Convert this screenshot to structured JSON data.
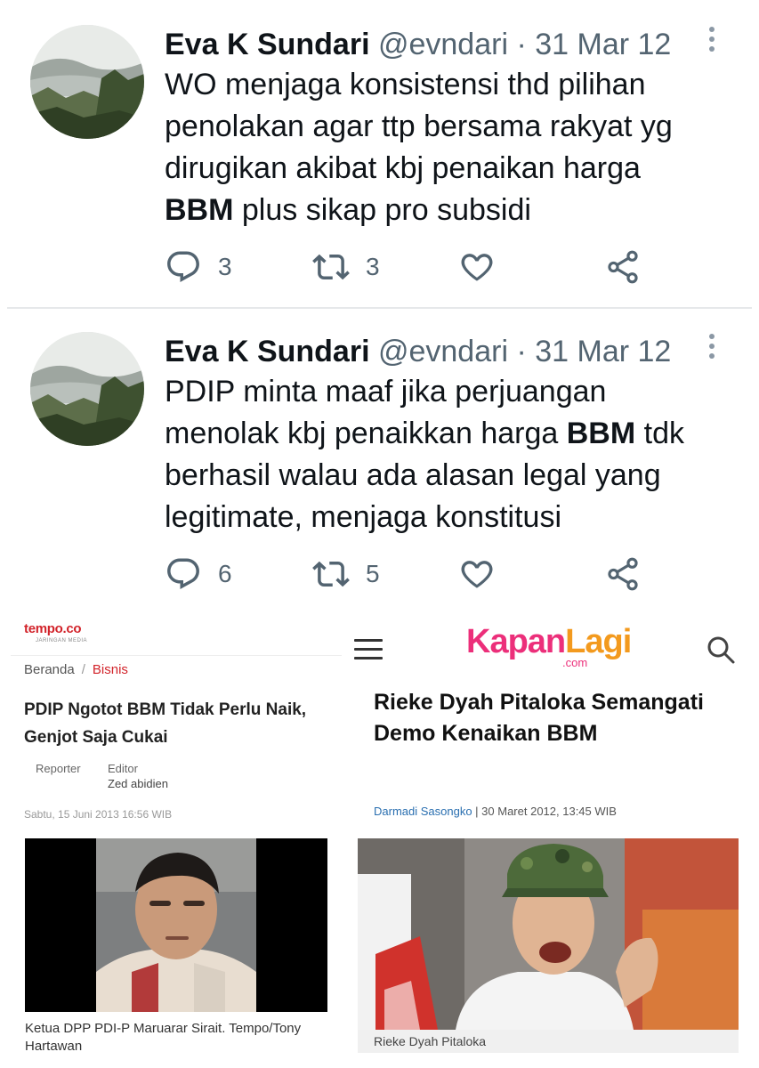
{
  "tweets": [
    {
      "author_name": "Eva K Sundari",
      "handle": "@evndari",
      "separator": "·",
      "date": "31 Mar 12",
      "text_lines": [
        "WO menjaga konsistensi thd pilihan",
        "penolakan agar ttp bersama rakyat yg",
        "dirugikan akibat kbj penaikan harga"
      ],
      "text_bold": "BBM",
      "text_tail": " plus sikap pro subsidi",
      "replies": "3",
      "retweets": "3"
    },
    {
      "author_name": "Eva K Sundari",
      "handle": "@evndari",
      "separator": "·",
      "date": "31 Mar 12",
      "line1": "PDIP minta maaf jika perjuangan",
      "line2_pre": "menolak kbj penaikkan harga ",
      "text_bold": "BBM",
      "line2_post": " tdk",
      "line3": "berhasil walau ada alasan legal yang",
      "line4": "legitimate, menjaga konstitusi",
      "replies": "6",
      "retweets": "5"
    }
  ],
  "tempo": {
    "logo": "tempo.co",
    "logo_sub": "JARINGAN MEDIA",
    "breadcrumb_home": "Beranda",
    "breadcrumb_sep": "/",
    "breadcrumb_section": "Bisnis",
    "title_line1": "PDIP Ngotot BBM Tidak Perlu Naik,",
    "title_line2": "Genjot Saja Cukai",
    "reporter_label": "Reporter",
    "editor_label": "Editor",
    "editor_name": "Zed abidien",
    "date": "Sabtu, 15 Juni 2013 16:56 WIB",
    "caption": "Ketua DPP PDI-P Maruarar Sirait. Tempo/Tony Hartawan"
  },
  "kapanlagi": {
    "logo_part1": "Kapan",
    "logo_part2": "Lagi",
    "logo_com": ".com",
    "title": "Rieke Dyah Pitaloka Semangati Demo Kenaikan BBM",
    "author": "Darmadi Sasongko",
    "meta_sep": " | ",
    "date": "30 Maret 2012, 13:45 WIB",
    "caption": "Rieke Dyah Pitaloka"
  },
  "colors": {
    "tempo_red": "#d2232a",
    "kl_pink": "#ec2f7a",
    "kl_orange": "#f39a1e",
    "twitter_gray": "#536471"
  }
}
